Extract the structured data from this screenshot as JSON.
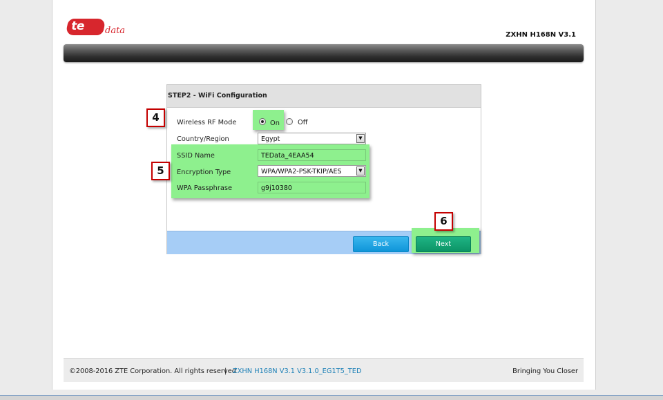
{
  "header": {
    "logo_text": "te",
    "logo_suffix": "data",
    "model": "ZXHN H168N V3.1"
  },
  "dialog": {
    "title": "STEP2 - WiFi Configuration",
    "wireless_rf_mode": {
      "label": "Wireless RF Mode",
      "options": [
        "On",
        "Off"
      ],
      "selected": "On"
    },
    "country_region": {
      "label": "Country/Region",
      "value": "Egypt"
    },
    "ssid_name": {
      "label": "SSID Name",
      "value": "TEData_4EAA54"
    },
    "encryption_type": {
      "label": "Encryption Type",
      "value": "WPA/WPA2-PSK-TKIP/AES"
    },
    "wpa_passphrase": {
      "label": "WPA Passphrase",
      "value": "g9j10380"
    },
    "buttons": {
      "back": "Back",
      "next": "Next"
    }
  },
  "annotations": {
    "marker_4": "4",
    "marker_5": "5",
    "marker_6": "6",
    "highlight_color": "#8ef08e",
    "marker_border_color": "#c40000"
  },
  "footer": {
    "copyright": "©2008-2016 ZTE Corporation. All rights reserved",
    "separator": "|",
    "version": "ZXHN H168N V3.1 V3.1.0_EG1T5_TED",
    "slogan": "Bringing You Closer"
  },
  "colors": {
    "brand_red": "#d7262d",
    "footer_link": "#1a7fb6",
    "back_button": "#1fa3e3",
    "next_button": "#13a475"
  },
  "icons": {
    "select_dropdown": "chevron-down-icon"
  }
}
